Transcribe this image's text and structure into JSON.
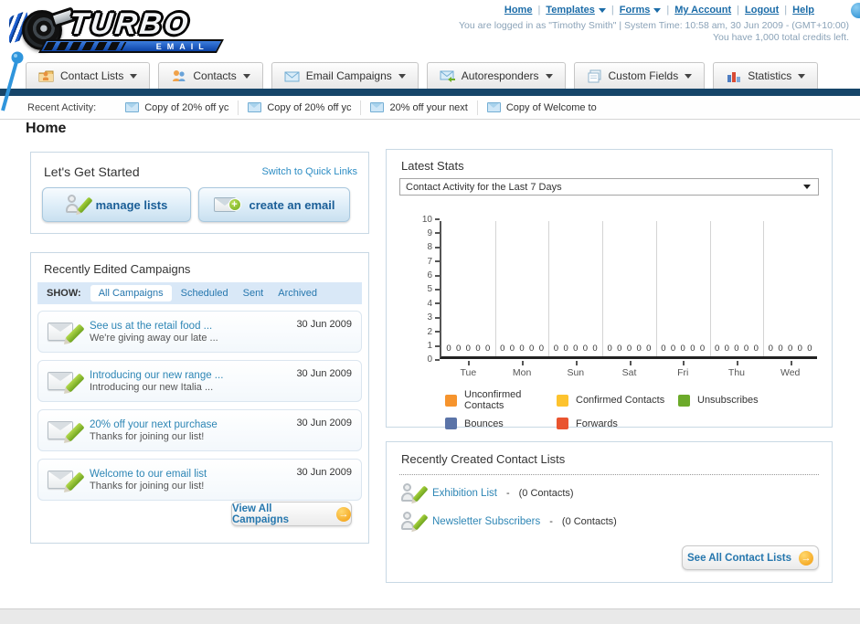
{
  "colors": {
    "link_blue": "#1b6ca8",
    "navy_bar": "#164569",
    "orange_arrow": "#f29b0d",
    "panel_border": "#c8d8e4"
  },
  "header": {
    "logo_title": "TURBO",
    "logo_subtitle": "EMAIL",
    "nav_links": {
      "home": "Home",
      "templates": "Templates",
      "forms": "Forms",
      "my_account": "My Account",
      "logout": "Logout",
      "help": "Help"
    },
    "login_info": "You are logged in as \"Timothy Smith\" | System Time: 10:58 am, 30 Jun 2009 - (GMT+10:00)",
    "credits_info": "You have 1,000 total credits left."
  },
  "nav_tabs": [
    {
      "label": "Contact Lists",
      "icon": "folder-user-icon"
    },
    {
      "label": "Contacts",
      "icon": "users-icon"
    },
    {
      "label": "Email Campaigns",
      "icon": "envelope-icon"
    },
    {
      "label": "Autoresponders",
      "icon": "envelope-arrow-icon"
    },
    {
      "label": "Custom Fields",
      "icon": "pages-icon"
    },
    {
      "label": "Statistics",
      "icon": "bar-chart-icon"
    }
  ],
  "recent_activity": {
    "label": "Recent Activity:",
    "items": [
      {
        "text": "Copy of 20% off yc",
        "icon": "envelope-icon"
      },
      {
        "text": "Copy of 20% off yc",
        "icon": "envelope-icon"
      },
      {
        "text": "20% off your next",
        "icon": "envelope-icon"
      },
      {
        "text": "Copy of Welcome to",
        "icon": "envelope-icon"
      }
    ]
  },
  "page": {
    "title": "Home"
  },
  "get_started": {
    "title": "Let's Get Started",
    "switch_link": "Switch to Quick Links",
    "manage_lists_label": "manage lists",
    "create_email_label": "create an email"
  },
  "campaigns": {
    "title": "Recently Edited Campaigns",
    "show_label": "SHOW:",
    "filters": [
      "All Campaigns",
      "Scheduled",
      "Sent",
      "Archived"
    ],
    "active_filter": "All Campaigns",
    "items": [
      {
        "title": "See us at the retail food ...",
        "subtitle": "We're giving away our late ...",
        "date": "30 Jun 2009"
      },
      {
        "title": "Introducing our new range ...",
        "subtitle": "Introducing our new Italia ...",
        "date": "30 Jun 2009"
      },
      {
        "title": "20% off your next purchase",
        "subtitle": "Thanks for joining our list!",
        "date": "30 Jun 2009"
      },
      {
        "title": "Welcome to our email list",
        "subtitle": "Thanks for joining our list!",
        "date": "30 Jun 2009"
      }
    ],
    "view_all_label": "View All Campaigns"
  },
  "stats": {
    "title": "Latest Stats",
    "dropdown_value": "Contact Activity for the Last 7 Days"
  },
  "chart_data": {
    "type": "bar",
    "title": "Contact Activity for the Last 7 Days",
    "categories": [
      "Tue",
      "Mon",
      "Sun",
      "Sat",
      "Fri",
      "Thu",
      "Wed"
    ],
    "series": [
      {
        "name": "Unconfirmed Contacts",
        "color": "#f6942d",
        "values": [
          0,
          0,
          0,
          0,
          0,
          0,
          0
        ]
      },
      {
        "name": "Confirmed Contacts",
        "color": "#fdc32e",
        "values": [
          0,
          0,
          0,
          0,
          0,
          0,
          0
        ]
      },
      {
        "name": "Unsubscribes",
        "color": "#6caa2a",
        "values": [
          0,
          0,
          0,
          0,
          0,
          0,
          0
        ]
      },
      {
        "name": "Bounces",
        "color": "#5b74a8",
        "values": [
          0,
          0,
          0,
          0,
          0,
          0,
          0
        ]
      },
      {
        "name": "Forwards",
        "color": "#e9542f",
        "values": [
          0,
          0,
          0,
          0,
          0,
          0,
          0
        ]
      }
    ],
    "ylim": [
      0,
      10
    ],
    "yticks": [
      0,
      1,
      2,
      3,
      4,
      5,
      6,
      7,
      8,
      9,
      10
    ],
    "grid": "vertical-only",
    "legend_position": "bottom",
    "data_labels": "each bar labeled 0"
  },
  "contact_lists": {
    "title": "Recently Created Contact Lists",
    "items": [
      {
        "name": "Exhibition List",
        "sep": "-",
        "count": "(0 Contacts)"
      },
      {
        "name": "Newsletter Subscribers",
        "sep": "-",
        "count": "(0 Contacts)"
      }
    ],
    "see_all_label": "See All Contact Lists"
  }
}
